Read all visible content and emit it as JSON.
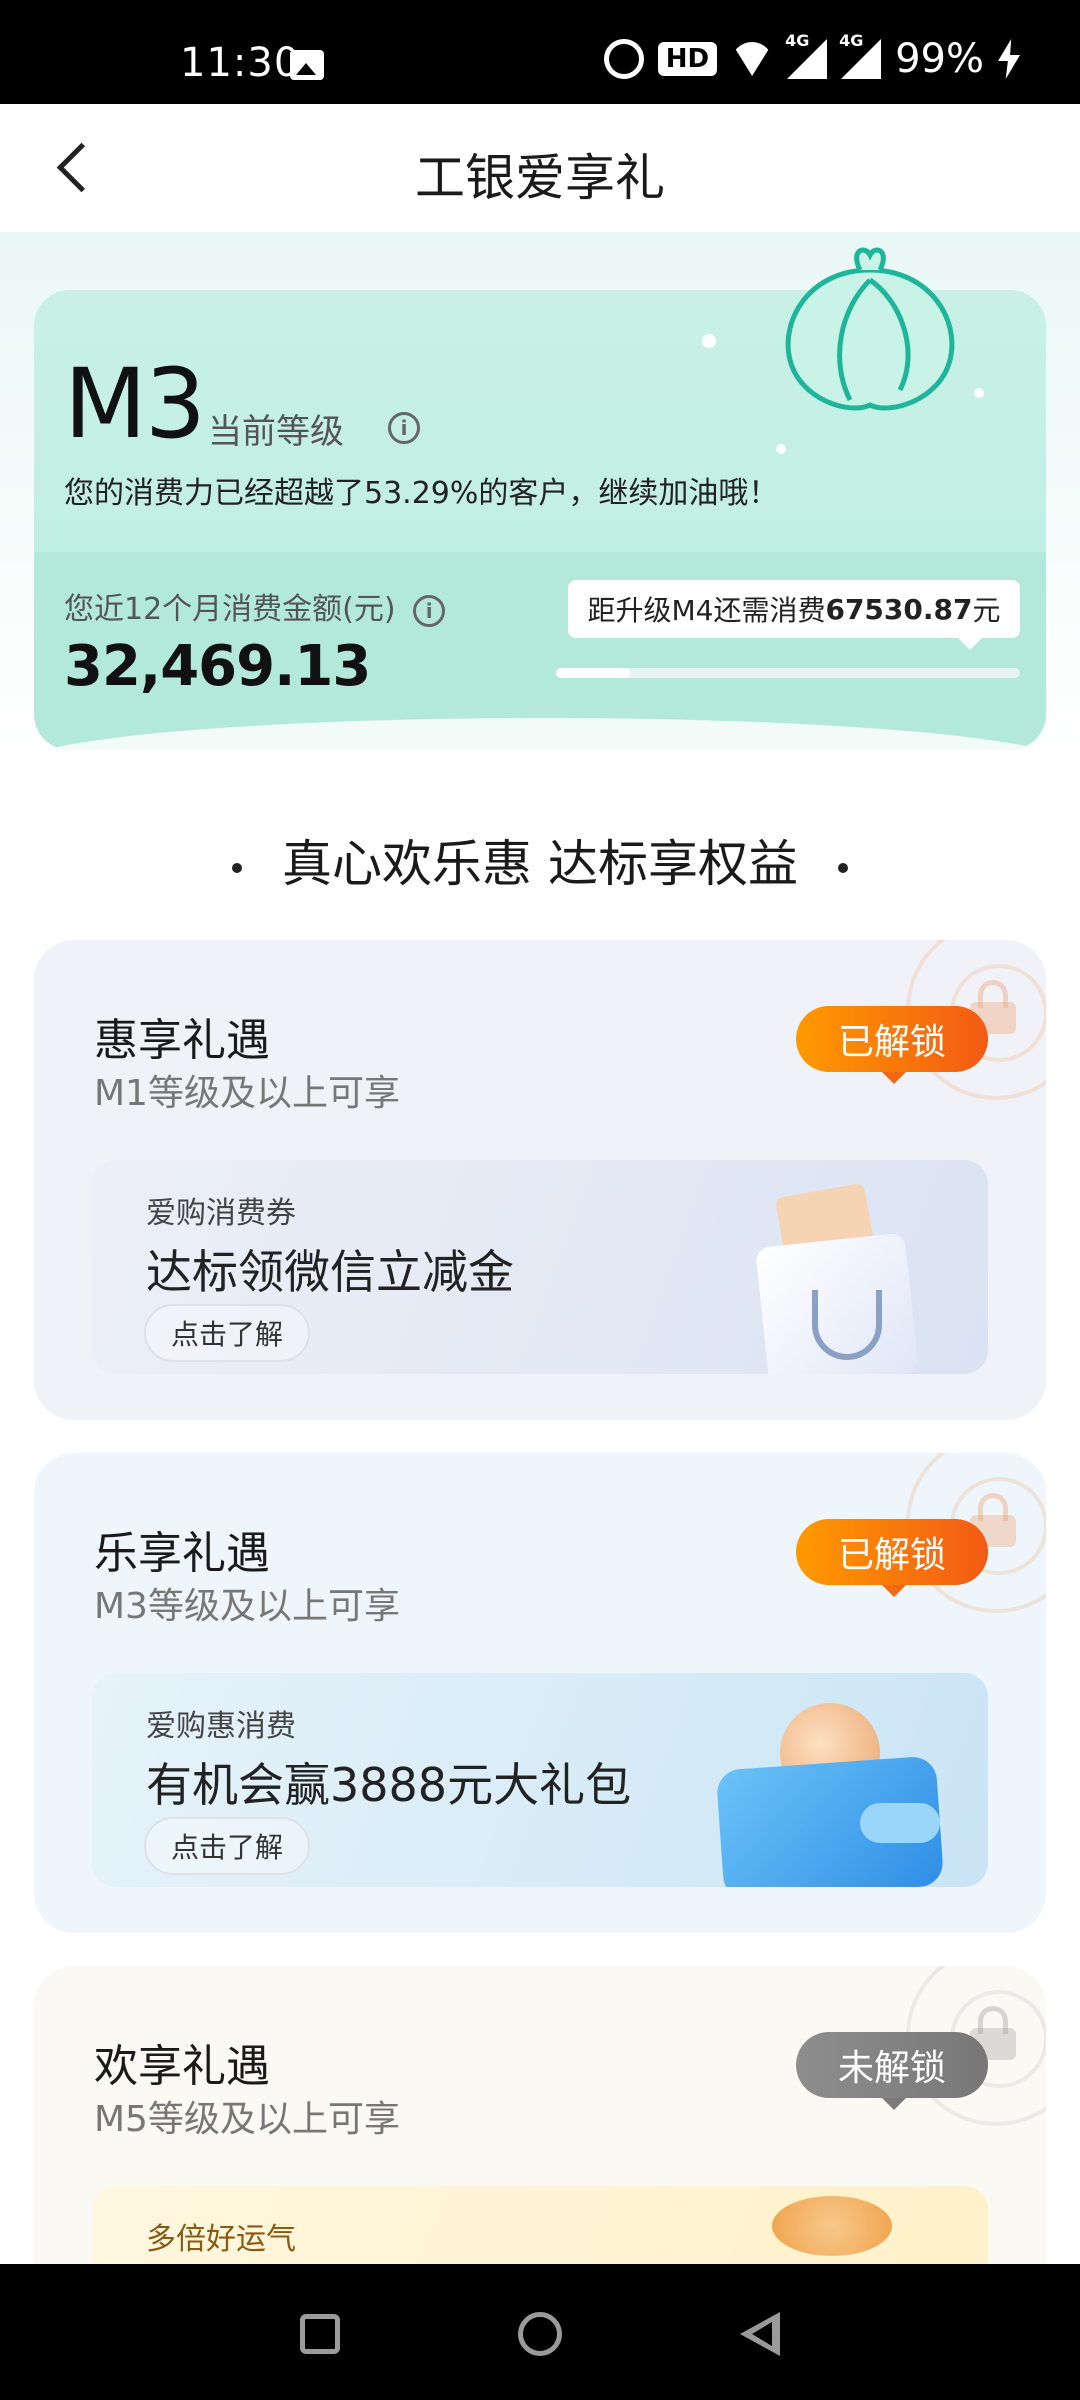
{
  "status_bar": {
    "time": "11:30",
    "hd_badge": "HD",
    "network_1": "4G",
    "network_2": "4G",
    "battery": "99%"
  },
  "header": {
    "title": "工银爱享礼"
  },
  "level": {
    "code": "M3",
    "label": "当前等级",
    "description": "您的消费力已经超越了53.29%的客户，继续加油哦！",
    "spend_label": "您近12个月消费金额(元)",
    "spend_value": "32,469.13",
    "upgrade_prefix": "距升级M4还需消费",
    "upgrade_amount": "67530.87",
    "upgrade_suffix": "元",
    "progress_fraction": 0.16
  },
  "section": {
    "heading": "真心欢乐惠 达标享权益"
  },
  "benefits": [
    {
      "name": "惠享礼遇",
      "requirement": "M1等级及以上可享",
      "status": "已解锁",
      "offer_sub": "爱购消费券",
      "offer_title": "达标领微信立减金",
      "button": "点击了解"
    },
    {
      "name": "乐享礼遇",
      "requirement": "M3等级及以上可享",
      "status": "已解锁",
      "offer_sub": "爱购惠消费",
      "offer_title": "有机会赢3888元大礼包",
      "button": "点击了解"
    },
    {
      "name": "欢享礼遇",
      "requirement": "M5等级及以上可享",
      "status": "未解锁",
      "offer_sub": "多倍好运气"
    }
  ],
  "colors": {
    "unlocked_pill": "#f25a14",
    "locked_pill": "#808080",
    "level_card": "#bdeee1"
  }
}
